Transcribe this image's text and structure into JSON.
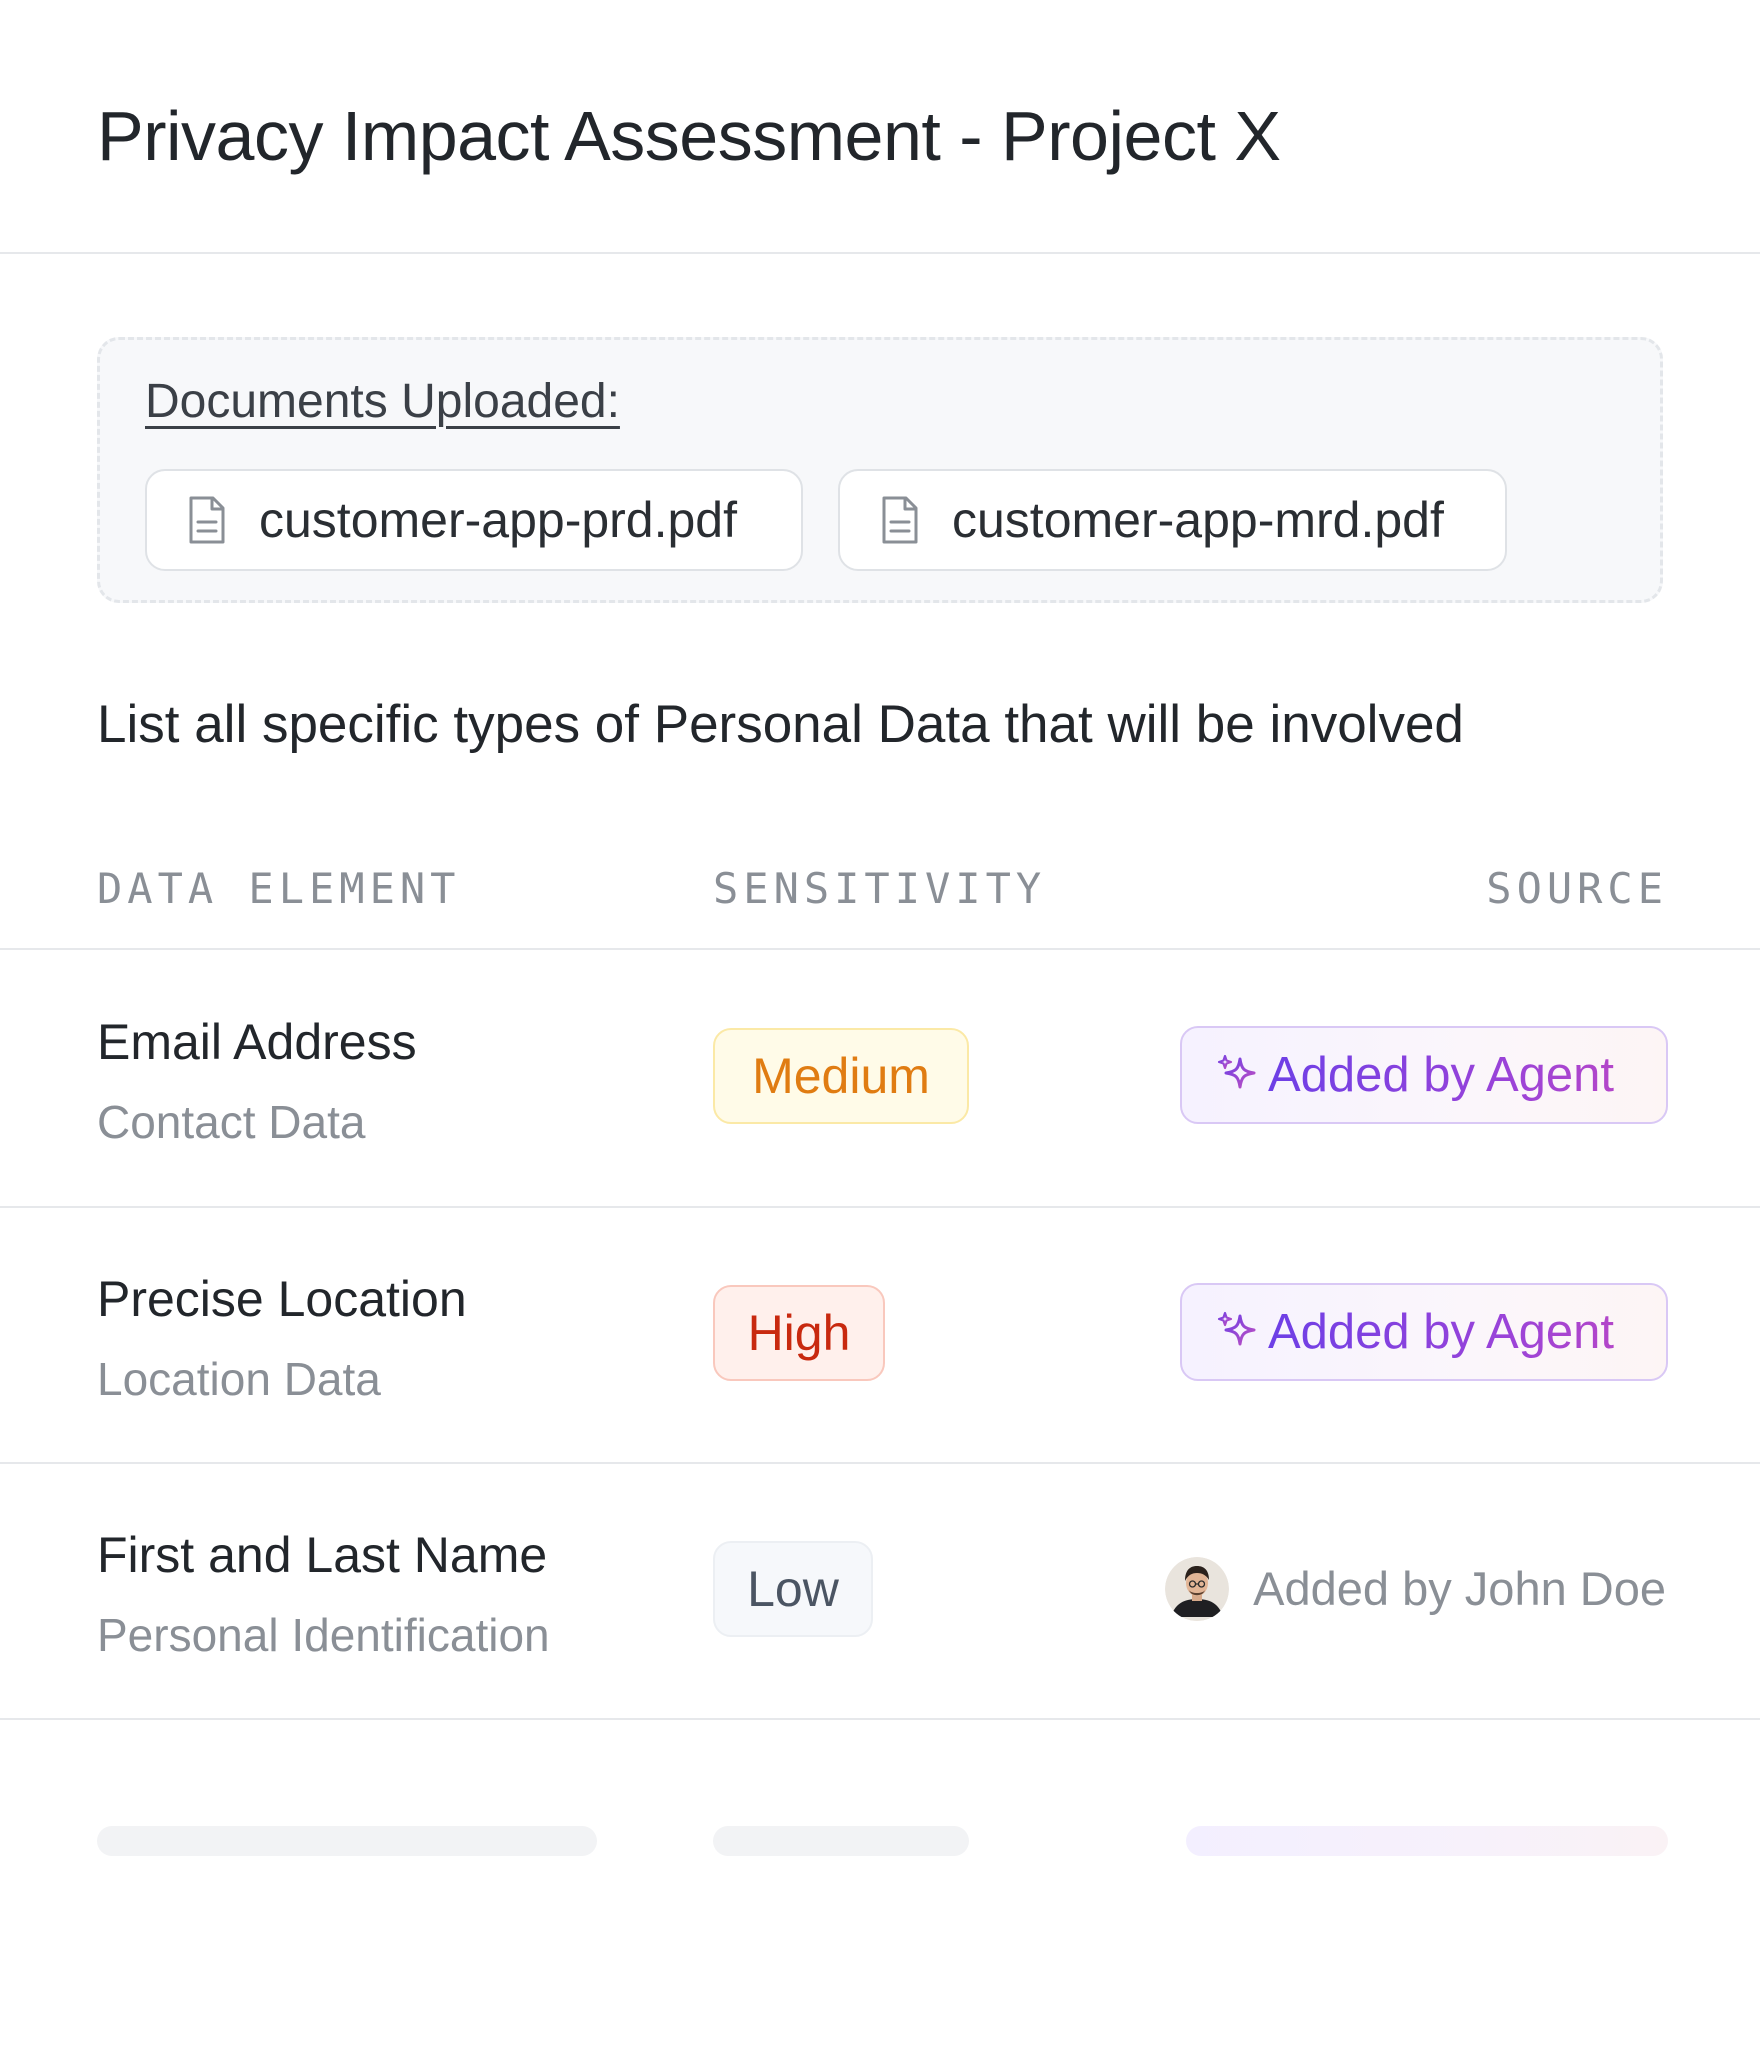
{
  "page": {
    "title": "Privacy Impact Assessment - Project X"
  },
  "documents": {
    "heading": "Documents Uploaded:",
    "files": [
      {
        "name": "customer-app-prd.pdf",
        "icon": "file-icon"
      },
      {
        "name": "customer-app-mrd.pdf",
        "icon": "file-icon"
      }
    ]
  },
  "question": "List all specific types of Personal Data that will be involved",
  "table": {
    "columns": [
      "DATA ELEMENT",
      "SENSITIVITY",
      "SOURCE"
    ],
    "rows": [
      {
        "element": "Email Address",
        "category": "Contact Data",
        "sensitivity": "Medium",
        "sensitivity_level": "medium",
        "source": "Added by Agent",
        "source_type": "agent",
        "source_icon": "sparkle-icon"
      },
      {
        "element": "Precise Location",
        "category": "Location Data",
        "sensitivity": "High",
        "sensitivity_level": "high",
        "source": "Added by Agent",
        "source_type": "agent",
        "source_icon": "sparkle-icon"
      },
      {
        "element": "First and Last Name",
        "category": "Personal Identification",
        "sensitivity": "Low",
        "sensitivity_level": "low",
        "source": "Added by John Doe",
        "source_type": "user",
        "source_icon": "avatar"
      }
    ]
  },
  "colors": {
    "medium_text": "#e07c12",
    "medium_bg": "#fffbe8",
    "high_text": "#c8290f",
    "high_bg": "#fff0ec",
    "low_text": "#4b5563",
    "low_bg": "#f6f8fb",
    "agent_accent": "#7a45e0"
  }
}
